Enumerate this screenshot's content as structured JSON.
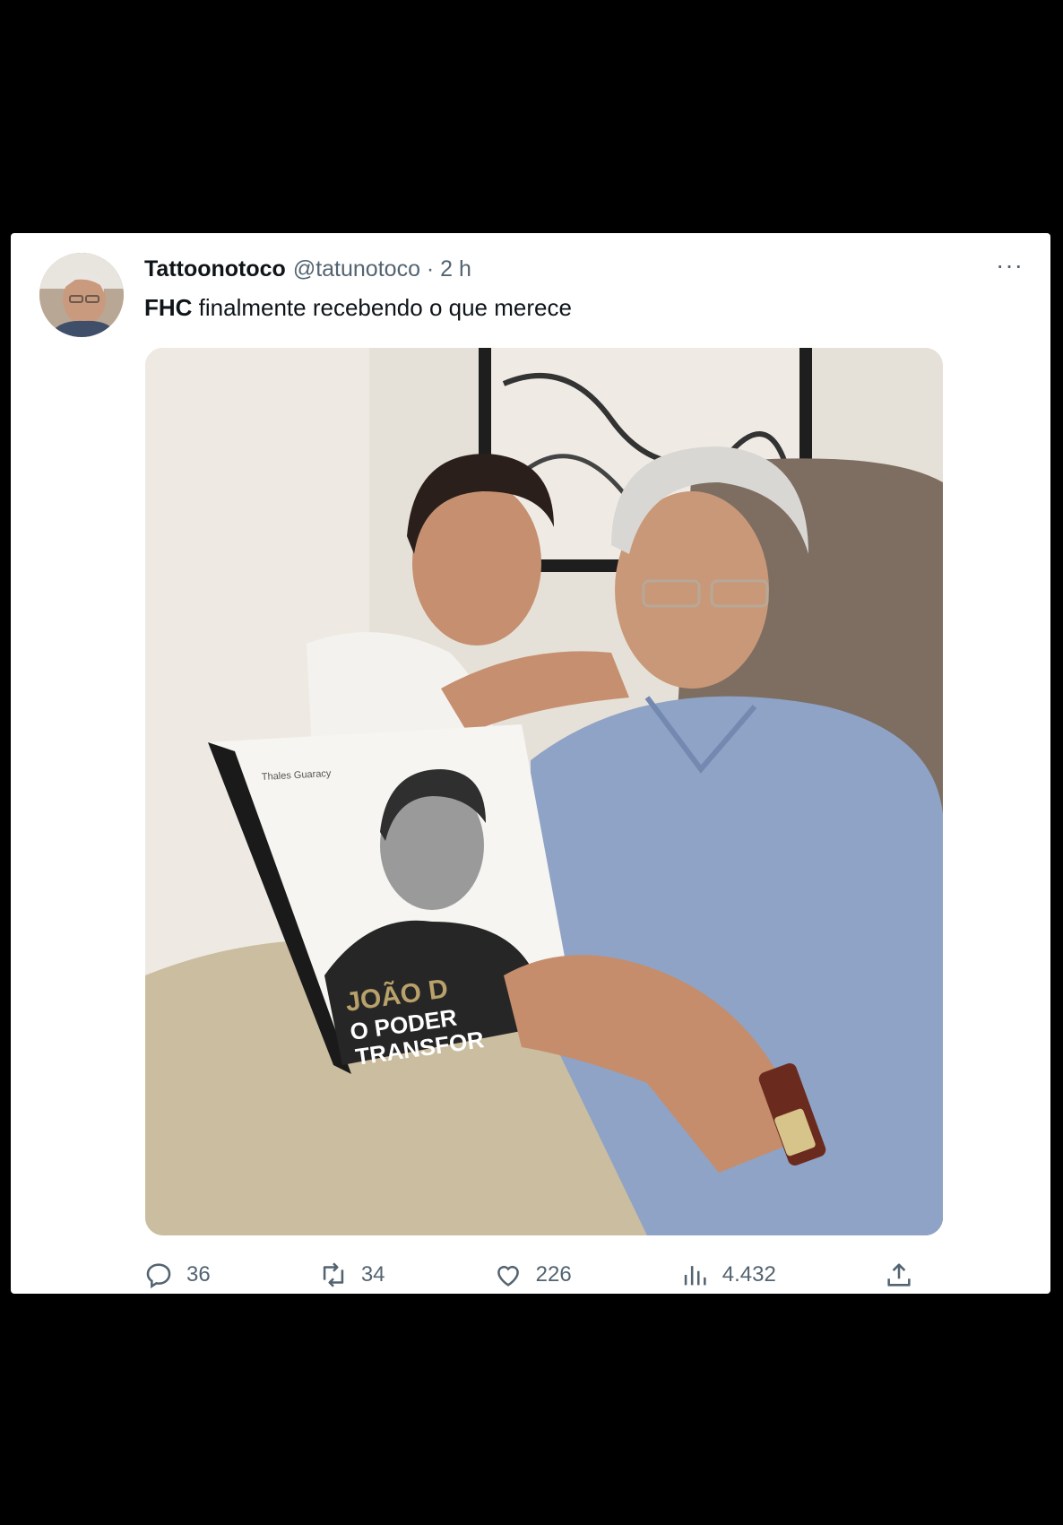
{
  "tweet": {
    "display_name": "Tattoonotoco",
    "handle_time": "@tatunotoco · 2 h",
    "more_label": "···",
    "text_bold": "FHC",
    "text_rest": " finalmente recebendo o que merece"
  },
  "book_cover": {
    "author": "Thales Guaracy",
    "title_line1": "JOÃO D",
    "title_line2": "O PODER",
    "title_line3": "TRANSFOR"
  },
  "actions": {
    "replies": "36",
    "retweets": "34",
    "likes": "226",
    "views": "4.432"
  },
  "icons": {
    "reply": "reply-icon",
    "retweet": "retweet-icon",
    "like": "heart-icon",
    "views": "views-icon",
    "share": "share-icon",
    "more": "more-icon"
  },
  "colors": {
    "background": "#000000",
    "card": "#ffffff",
    "text": "#0f1419",
    "secondary": "#536471"
  }
}
